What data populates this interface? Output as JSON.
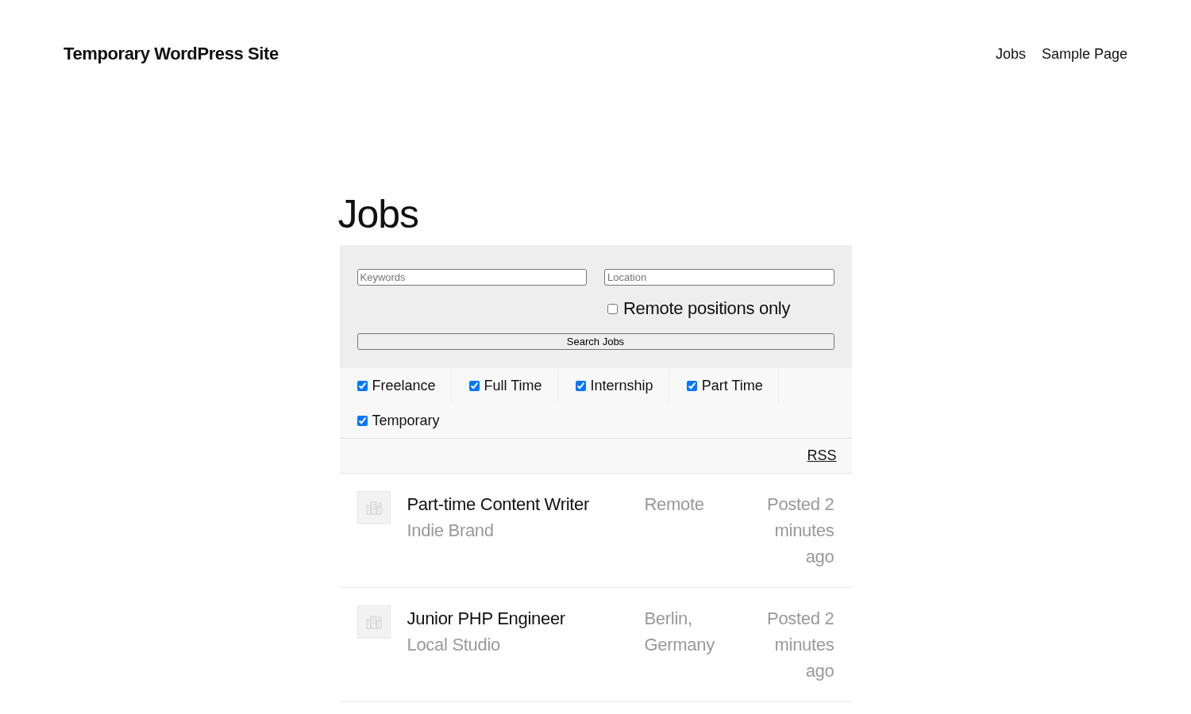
{
  "site": {
    "title": "Temporary WordPress Site"
  },
  "nav": [
    {
      "label": "Jobs"
    },
    {
      "label": "Sample Page"
    }
  ],
  "page": {
    "title": "Jobs"
  },
  "search": {
    "keywords": {
      "placeholder": "Keywords"
    },
    "location": {
      "placeholder": "Location"
    },
    "remote": {
      "label": "Remote positions only",
      "checked": false
    },
    "button": "Search Jobs"
  },
  "job_types": [
    {
      "label": "Freelance",
      "checked": true
    },
    {
      "label": "Full Time",
      "checked": true
    },
    {
      "label": "Internship",
      "checked": true
    },
    {
      "label": "Part Time",
      "checked": true
    },
    {
      "label": "Temporary",
      "checked": true
    }
  ],
  "rss": "RSS",
  "jobs": [
    {
      "title": "Part-time Content Writer",
      "company": "Indie Brand",
      "location": "Remote",
      "posted": "Posted 2 minutes ago"
    },
    {
      "title": "Junior PHP Engineer",
      "company": "Local Studio",
      "location": "Berlin, Germany",
      "posted": "Posted 2 minutes ago"
    }
  ]
}
